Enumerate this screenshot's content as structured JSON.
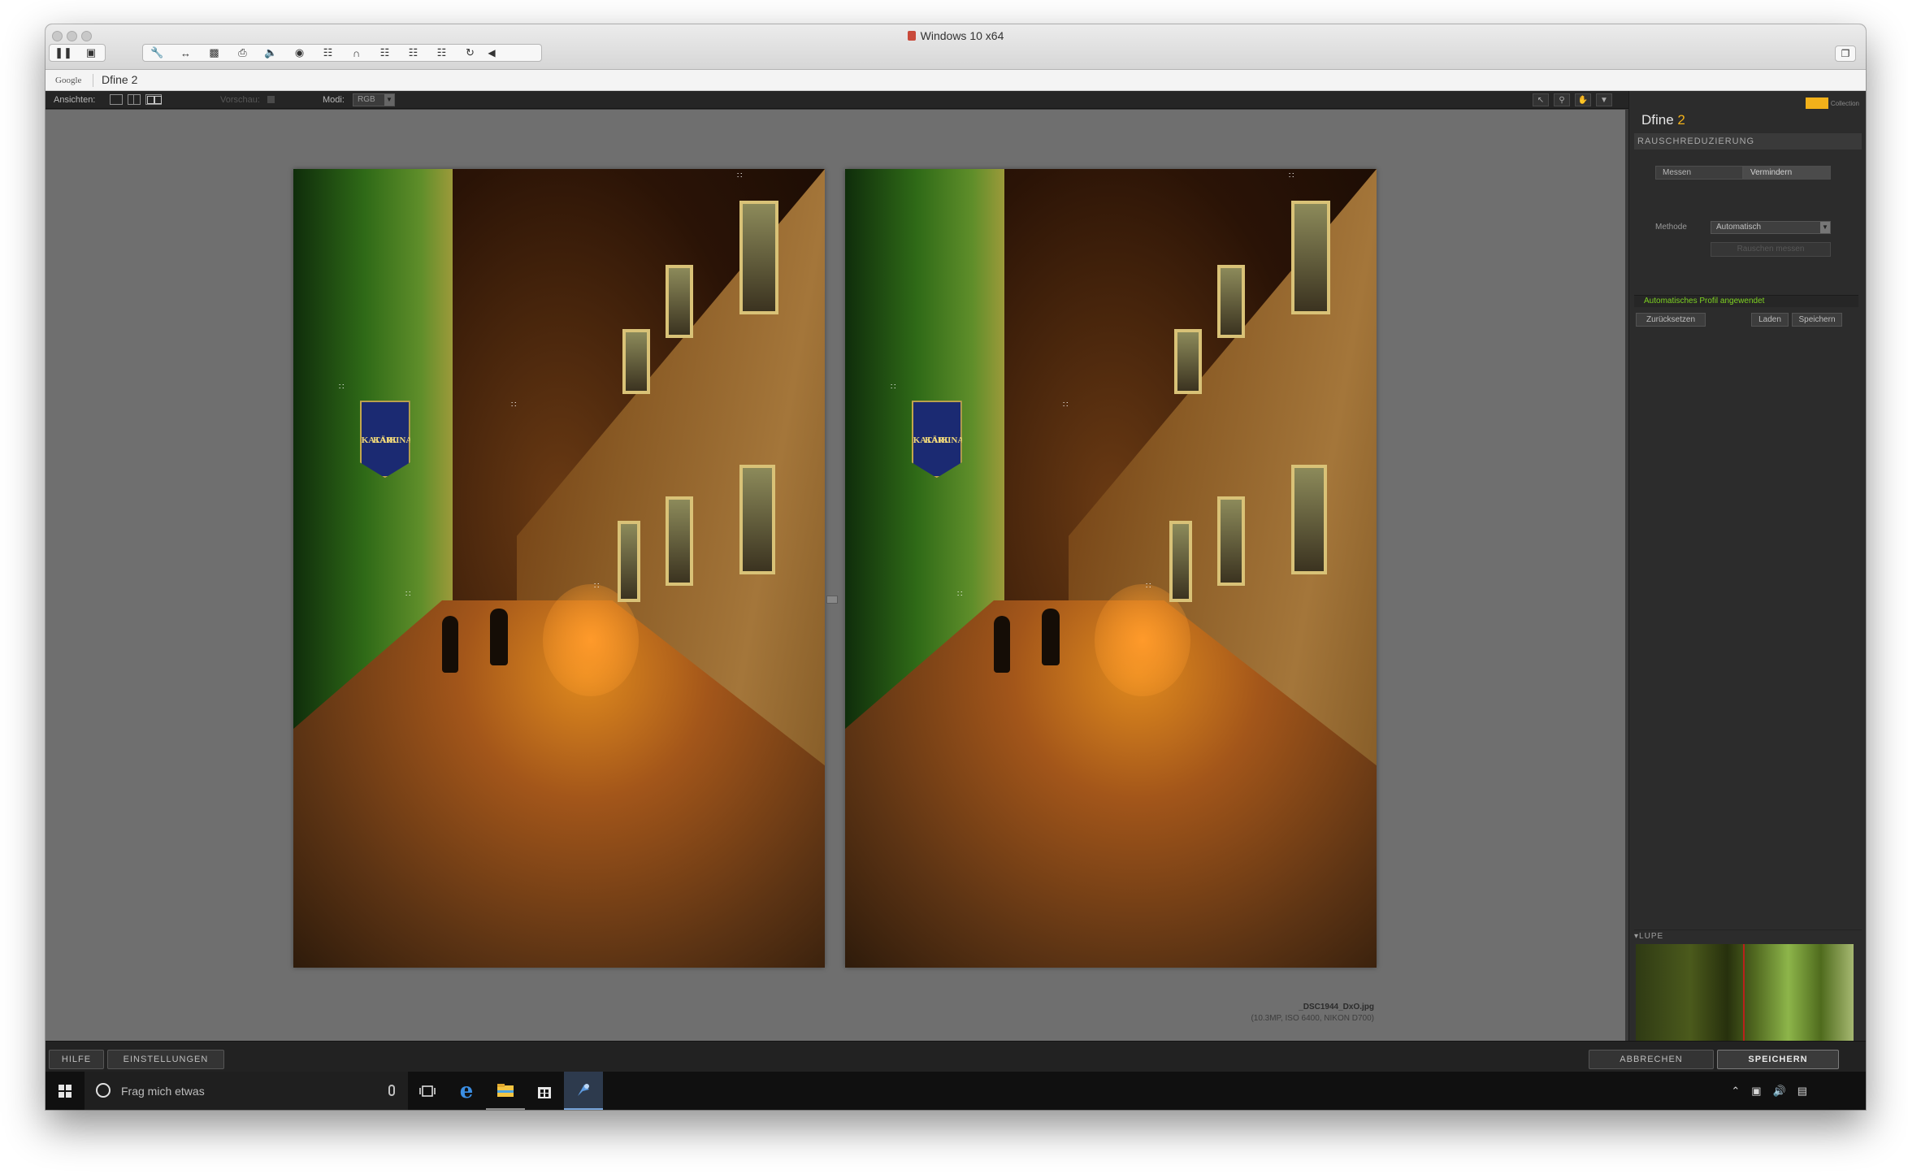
{
  "vm_window": {
    "title": "Windows 10 x64",
    "toolbar_icons": [
      "pause-icon",
      "snapshot-icon",
      "wrench-icon",
      "resize-icon",
      "disk-icon",
      "printer-icon",
      "speaker-icon",
      "camera-icon",
      "usb-icon",
      "headset-icon",
      "lock-icon",
      "lock-icon",
      "lock-icon",
      "refresh-icon",
      "chevron-left-icon"
    ]
  },
  "host_bar": {
    "brand": "Google",
    "app_name": "Dfine 2"
  },
  "control_bar": {
    "views_label": "Ansichten:",
    "preview_label": "Vorschau:",
    "mode_label": "Modi:",
    "mode_value": "RGB"
  },
  "image_info": {
    "filename": "_DSC1944_DxO.jpg",
    "meta": "(10.3MP, ISO 6400, NIKON D700)"
  },
  "photo": {
    "sign_line1": "KATARIINA",
    "sign_line2": "KÄIK"
  },
  "panel": {
    "badge_text": "Collection",
    "title_app": "Dfine",
    "title_version": "2",
    "section": "RAUSCHREDUZIERUNG",
    "tab_measure": "Messen",
    "tab_reduce": "Vermindern",
    "method_label": "Methode",
    "method_value": "Automatisch",
    "measure_button": "Rauschen messen",
    "status": "Automatisches Profil angewendet",
    "reset_button": "Zurücksetzen",
    "load_button": "Laden",
    "save_button": "Speichern",
    "loupe_label": "LUPE"
  },
  "bottom_bar": {
    "help": "HILFE",
    "settings": "EINSTELLUNGEN",
    "cancel": "ABBRECHEN",
    "save": "SPEICHERN"
  },
  "taskbar": {
    "search_placeholder": "Frag mich etwas",
    "apps": [
      "task-view-icon",
      "edge-icon",
      "file-explorer-icon",
      "store-icon",
      "dfine-app-icon"
    ]
  },
  "colors": {
    "accent": "#f2b11a",
    "status_green": "#7ed321",
    "panel_bg": "#2c2c2c",
    "canvas_bg": "#6f6f6f"
  }
}
